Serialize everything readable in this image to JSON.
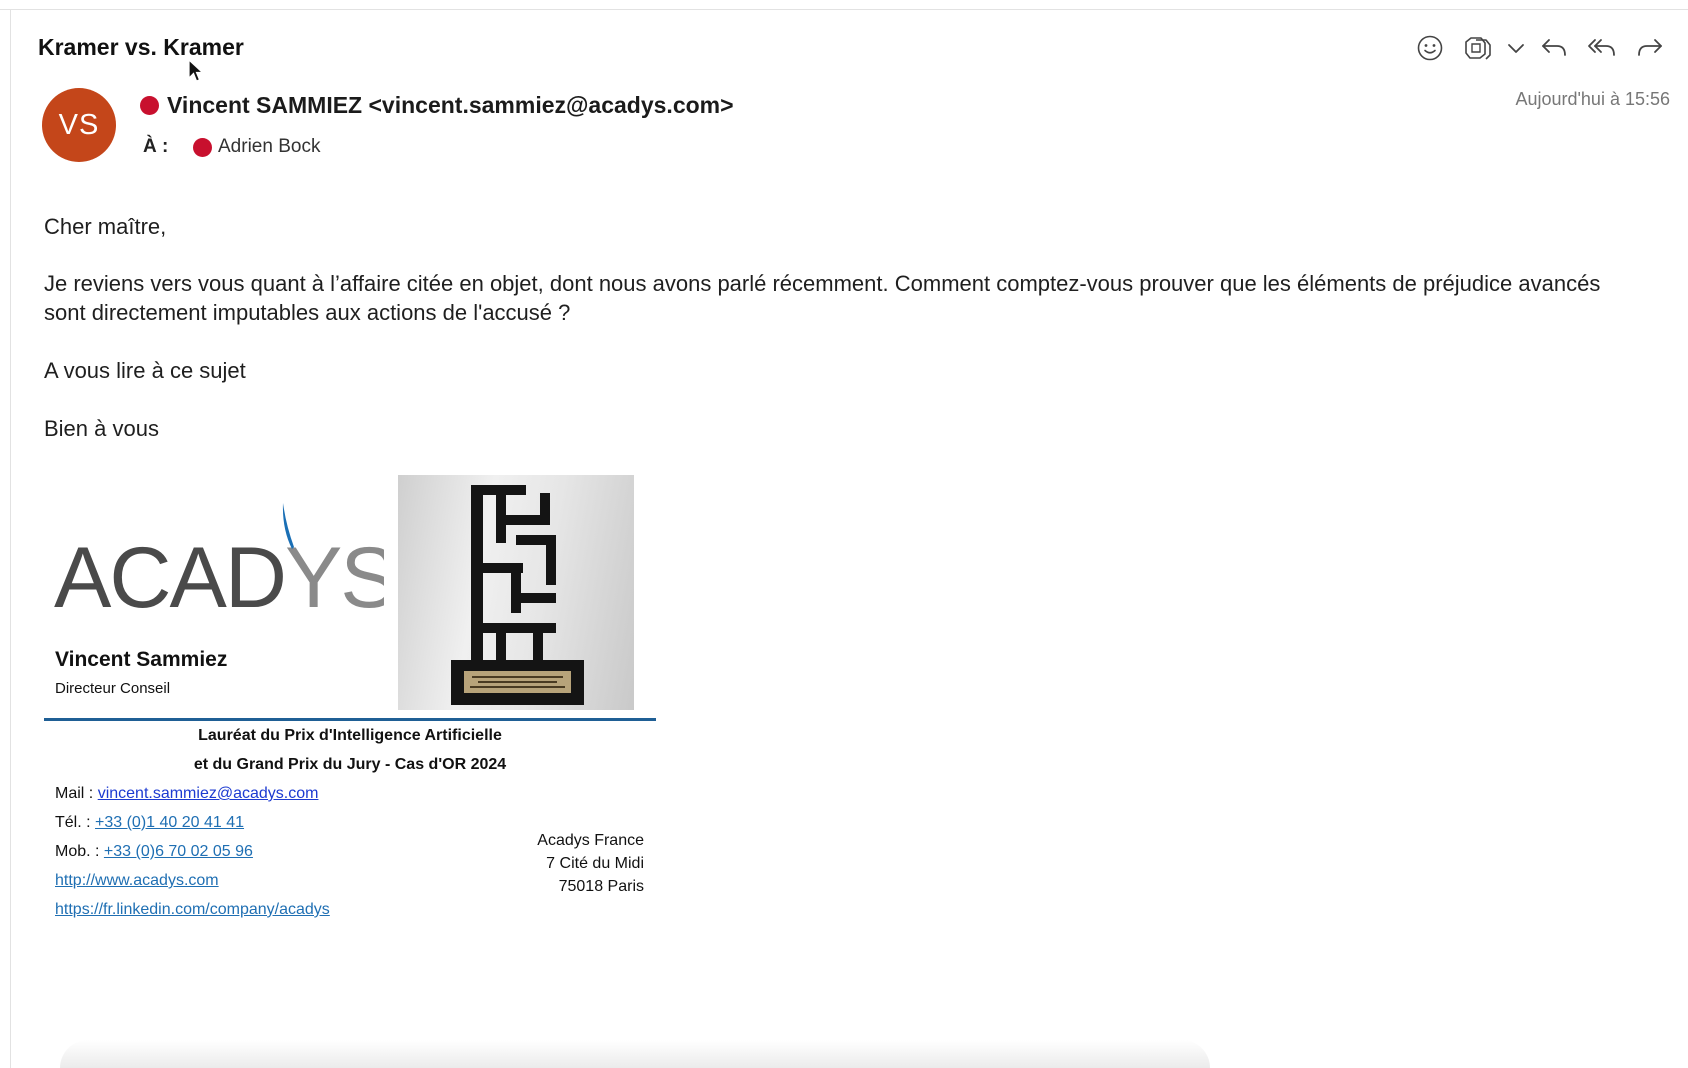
{
  "email": {
    "subject": "Kramer vs. Kramer",
    "sender": {
      "initials": "VS",
      "display": "Vincent SAMMIEZ <vincent.sammiez@acadys.com>",
      "status_color": "#c8102e",
      "avatar_color": "#c4461a"
    },
    "to_label": "À :",
    "recipient": "Adrien Bock",
    "date": "Aujourd'hui à 15:56",
    "body": {
      "greeting": "Cher maître,",
      "paragraph": "Je reviens vers vous quant à l’affaire citée en objet, dont nous avons parlé récemment. Comment comptez-vous prouver que les éléments de préjudice avancés sont directement imputables aux actions de l'accusé ?",
      "closing1": "A vous lire à ce sujet",
      "closing2": "Bien à vous"
    }
  },
  "toolbar": {
    "icons": [
      "emoji-icon",
      "copilot-icon",
      "chevron-down-icon",
      "reply-icon",
      "reply-all-icon",
      "forward-icon"
    ]
  },
  "signature": {
    "logo_text": "ACADYS",
    "name": "Vincent Sammiez",
    "title": "Directeur Conseil",
    "award_line1": "Lauréat du Prix d'Intelligence Artificielle",
    "award_line2": "et du Grand Prix du Jury - Cas d'OR 2024",
    "mail_label": "Mail :",
    "mail": "vincent.sammiez@acadys.com",
    "tel_label": "Tél. :",
    "tel": "+33 (0)1 40 20 41 41",
    "mob_label": "Mob. :",
    "mob": "+33 (0)6 70 02 05 96",
    "website": "http://www.acadys.com",
    "linkedin": "https://fr.linkedin.com/company/acadys",
    "address1": "Acadys France",
    "address2": "7 Cité du Midi",
    "address3": "75018 Paris"
  },
  "colors": {
    "accent_rule": "#1f5f95",
    "link": "#1f6fb3"
  }
}
